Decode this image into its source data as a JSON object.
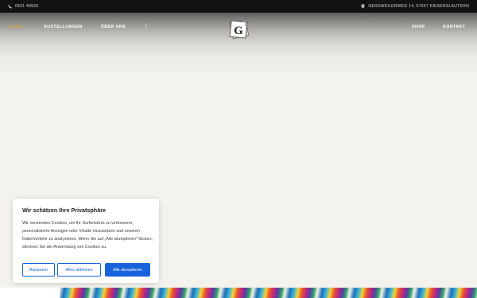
{
  "topbar": {
    "phone": "0631 46550",
    "address": "GERSWEILERWEG 14, 67657 KAISERSLAUTERN"
  },
  "nav": {
    "home": "HOME",
    "exhibitions": "AUSTELLUNGEN",
    "about": "ÜBER UNS",
    "shop": "SHOP",
    "contact": "KONTAKT"
  },
  "logo": {
    "letter": "G"
  },
  "cookie_banner": {
    "title": "Wir schätzen Ihre Privatsphäre",
    "body": "Wir verwenden Cookies, um Ihr Surferlebnis zu verbessern, personalisierte Anzeigen oder Inhalte einzusetzen und unseren Datenverkehr zu analysieren. Wenn Sie auf „Alle akzeptieren\" klicken, stimmen Sie der Anwendung von Cookies zu.",
    "customize_label": "Anpassen",
    "reject_label": "Alles ablehnen",
    "accept_label": "Alle akzeptieren"
  },
  "colors": {
    "topbar": "#121212",
    "nav_active": "#c9a34a",
    "accent_blue": "#1863dc",
    "page_background": "#f3f2ed"
  },
  "icons": {
    "phone": "phone-icon",
    "location": "location-pin-icon",
    "more": "vertical-dots-icon"
  }
}
